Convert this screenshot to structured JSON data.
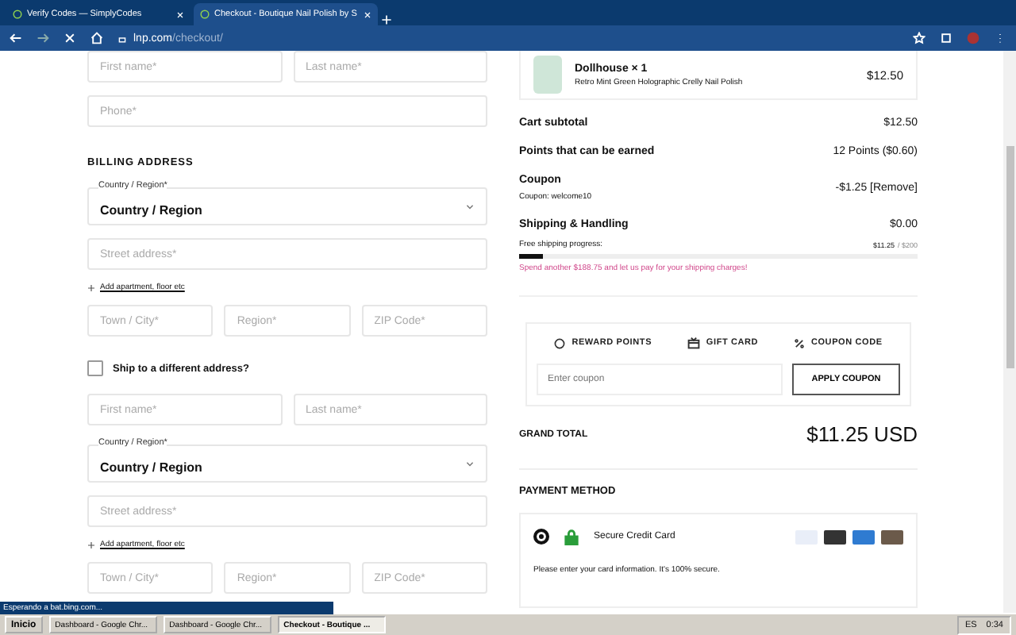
{
  "browser": {
    "tabs": [
      {
        "title": "Verify Codes — SimplyCodes",
        "selected": false
      },
      {
        "title": "Checkout - Boutique Nail Polish by S",
        "selected": true
      }
    ],
    "url_host": "lnp.com",
    "url_path": "/checkout/"
  },
  "left": [
    {
      "kind": "row",
      "fields": [
        {
          "placeholder": "First name*"
        },
        {
          "placeholder": "Last name*"
        }
      ]
    },
    {
      "kind": "row",
      "fields": [
        {
          "placeholder": "Phone*"
        }
      ]
    },
    {
      "kind": "heading",
      "text": "BILLING ADDRESS"
    },
    {
      "kind": "select",
      "label": "Country / Region*",
      "value": "Country / Region"
    },
    {
      "kind": "row",
      "fields": [
        {
          "placeholder": "Street address*"
        }
      ]
    },
    {
      "kind": "link",
      "text": "Add apartment, floor etc"
    },
    {
      "kind": "row",
      "fields": [
        {
          "placeholder": "Town / City*"
        },
        {
          "placeholder": "Region*"
        },
        {
          "placeholder": "ZIP Code*"
        }
      ]
    },
    {
      "kind": "checkbox",
      "text": "Ship to a different address?",
      "checked": false
    },
    {
      "kind": "row",
      "fields": [
        {
          "placeholder": "First name*"
        },
        {
          "placeholder": "Last name*"
        }
      ]
    },
    {
      "kind": "select",
      "label": "Country / Region*",
      "value": "Country / Region"
    },
    {
      "kind": "row",
      "fields": [
        {
          "placeholder": "Street address*"
        }
      ]
    },
    {
      "kind": "link",
      "text": "Add apartment, floor etc"
    },
    {
      "kind": "row",
      "fields": [
        {
          "placeholder": "Town / City*"
        },
        {
          "placeholder": "Region*"
        },
        {
          "placeholder": "ZIP Code*"
        }
      ]
    }
  ],
  "product": {
    "name": "Dollhouse × 1",
    "variant": "Retro Mint Green Holographic Crelly Nail Polish",
    "price": "$12.50"
  },
  "summary": [
    {
      "label": "Cart subtotal",
      "value": "$12.50"
    },
    {
      "label": "Points that can be earned",
      "value": "12 Points ($0.60)"
    },
    {
      "label": "Coupon",
      "note": "Coupon: welcome10",
      "value": "-$1.25 [Remove]"
    },
    {
      "label": "Shipping & Handling",
      "value": "$0.00"
    }
  ],
  "shipping_progress": {
    "label": "Free shipping progress:",
    "amount": "$11.25",
    "target": "/ $200",
    "level": 0.06,
    "message": "Spend another $188.75 and let us pay for your shipping charges!"
  },
  "discount_tabs": [
    {
      "label": "REWARD POINTS",
      "kind": "points"
    },
    {
      "label": "GIFT CARD",
      "kind": "gift"
    },
    {
      "label": "COUPON CODE",
      "kind": "percent"
    }
  ],
  "coupon": {
    "placeholder": "Enter coupon",
    "button": "APPLY COUPON"
  },
  "grand_total": {
    "label": "GRAND TOTAL",
    "value": "$11.25 USD"
  },
  "payment": {
    "heading": "PAYMENT METHOD",
    "method": "Secure Credit Card",
    "selected": true,
    "note": "Please enter your card information. It's 100% secure."
  },
  "status": "Esperando a bat.bing.com...",
  "taskbar": {
    "start": "Inicio",
    "tasks": [
      {
        "title": "Dashboard - Google Chr...",
        "selected": false
      },
      {
        "title": "Dashboard - Google Chr...",
        "selected": false
      },
      {
        "title": "Checkout - Boutique ...",
        "selected": true
      }
    ],
    "lang": "ES",
    "time": "0:34"
  }
}
